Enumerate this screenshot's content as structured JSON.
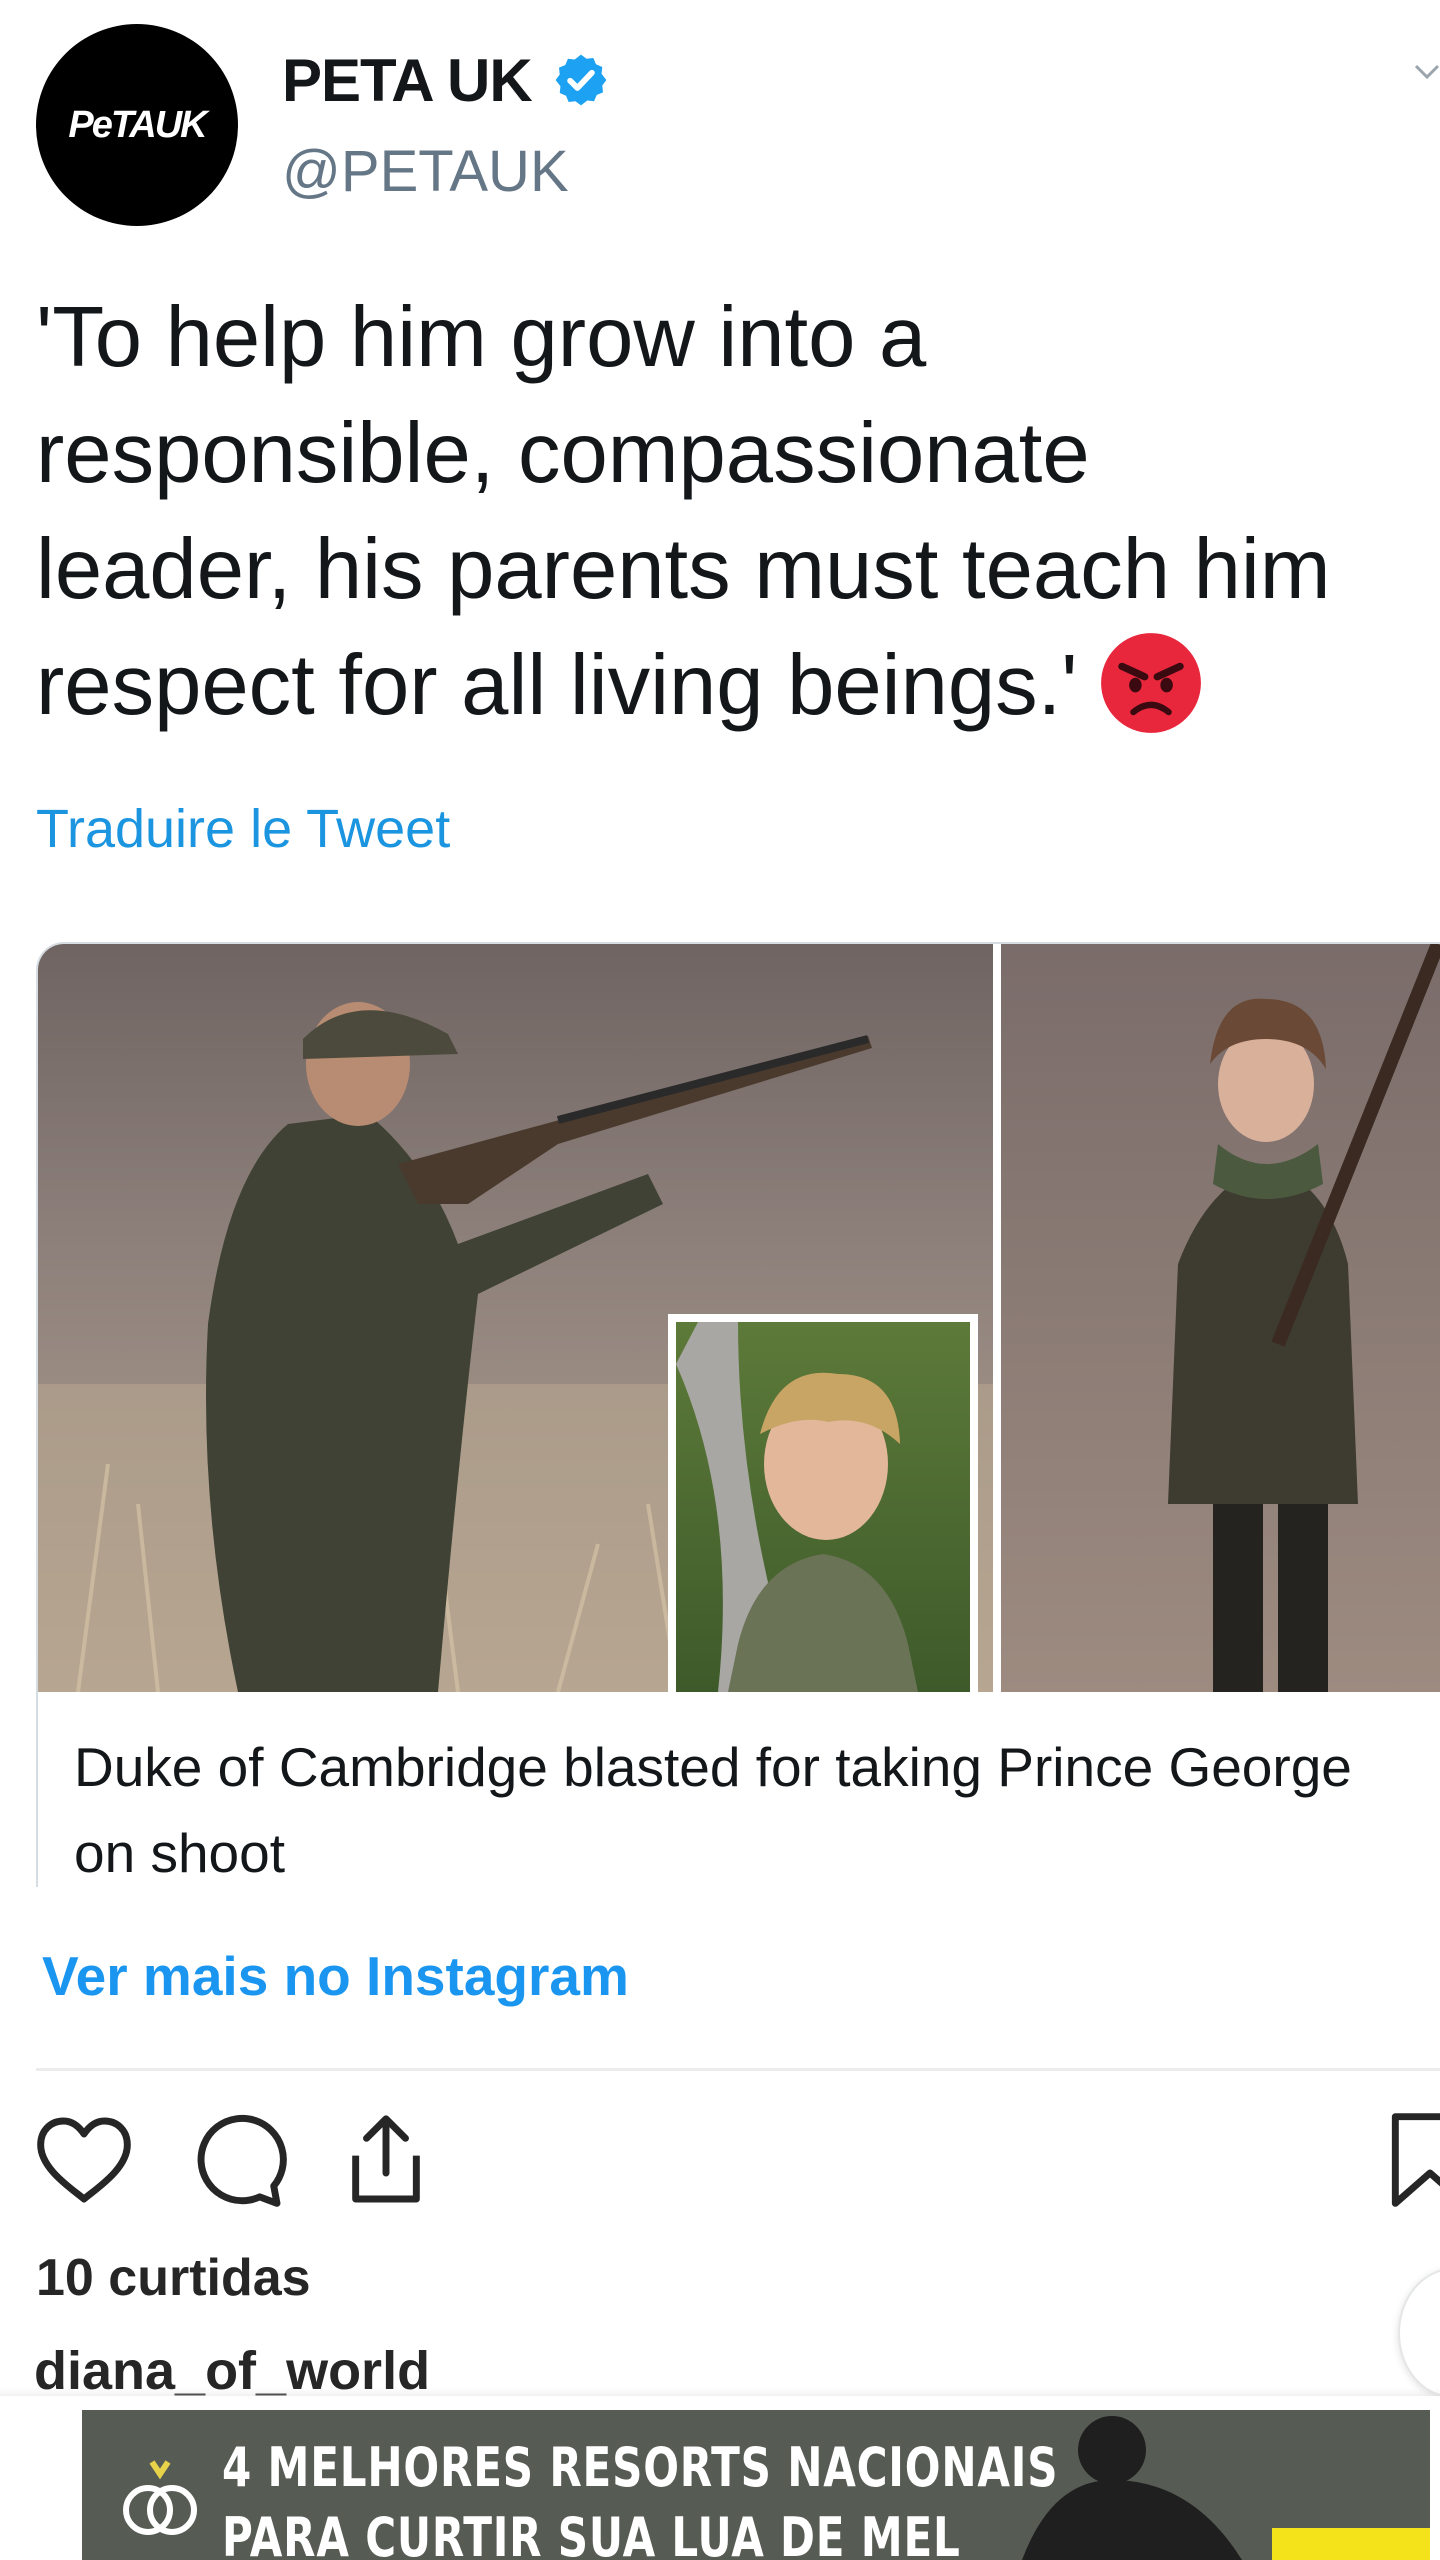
{
  "tweet": {
    "display_name": "PETA UK",
    "handle": "@PETAUK",
    "avatar_text": "PeTAUK",
    "text_lines": [
      "'To help him grow into a",
      "responsible, compassionate",
      "leader, his parents must teach him",
      "respect for all living beings.'"
    ],
    "emoji": "angry-face-icon",
    "translate_label": "Traduire le Tweet",
    "card": {
      "headline": "Duke of Cambridge blasted for taking Prince George on shoot"
    }
  },
  "instagram": {
    "more_link": "Ver mais no Instagram",
    "likes": "10 curtidas",
    "username": "diana_of_world",
    "icons": [
      "heart-icon",
      "comment-icon",
      "share-icon",
      "bookmark-icon"
    ]
  },
  "ad": {
    "line1": "4 MELHORES RESORTS NACIONAIS",
    "line2": "PARA CURTIR SUA LUA DE MEL"
  },
  "colors": {
    "verified": "#1da1f2",
    "link_blue": "#1b95e0",
    "instagram_blue": "#1a96f0",
    "angry_red": "#e8273d",
    "ad_background": "#565b53",
    "ad_cta": "#f4e21a"
  }
}
